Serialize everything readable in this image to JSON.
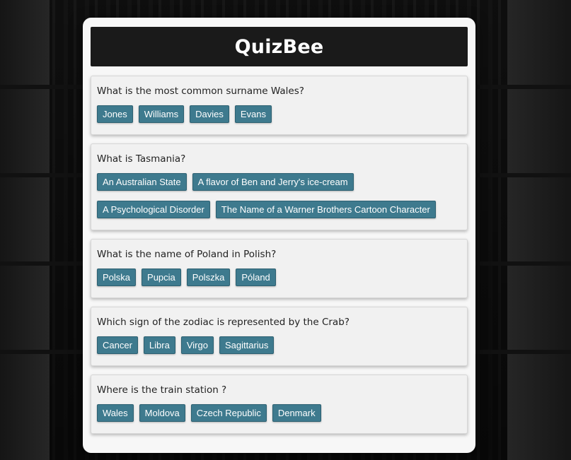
{
  "app": {
    "title": "QuizBee"
  },
  "colors": {
    "header_bg": "#1a1a1a",
    "button_bg": "#3e7a8e",
    "card_bg": "#f7f7f7"
  },
  "questions": [
    {
      "text": "What is the most common surname Wales?",
      "answers": [
        "Jones",
        "Williams",
        "Davies",
        "Evans"
      ]
    },
    {
      "text": "What is Tasmania?",
      "answers": [
        "An Australian State",
        "A flavor of Ben and Jerry's ice-cream",
        "A Psychological Disorder",
        "The Name of a Warner Brothers Cartoon Character"
      ]
    },
    {
      "text": "What is the name of Poland in Polish?",
      "answers": [
        "Polska",
        "Pupcia",
        "Polszka",
        "Póland"
      ]
    },
    {
      "text": "Which sign of the zodiac is represented by the Crab?",
      "answers": [
        "Cancer",
        "Libra",
        "Virgo",
        "Sagittarius"
      ]
    },
    {
      "text": "Where is the train station ?",
      "answers": [
        "Wales",
        "Moldova",
        "Czech Republic",
        "Denmark"
      ]
    }
  ]
}
